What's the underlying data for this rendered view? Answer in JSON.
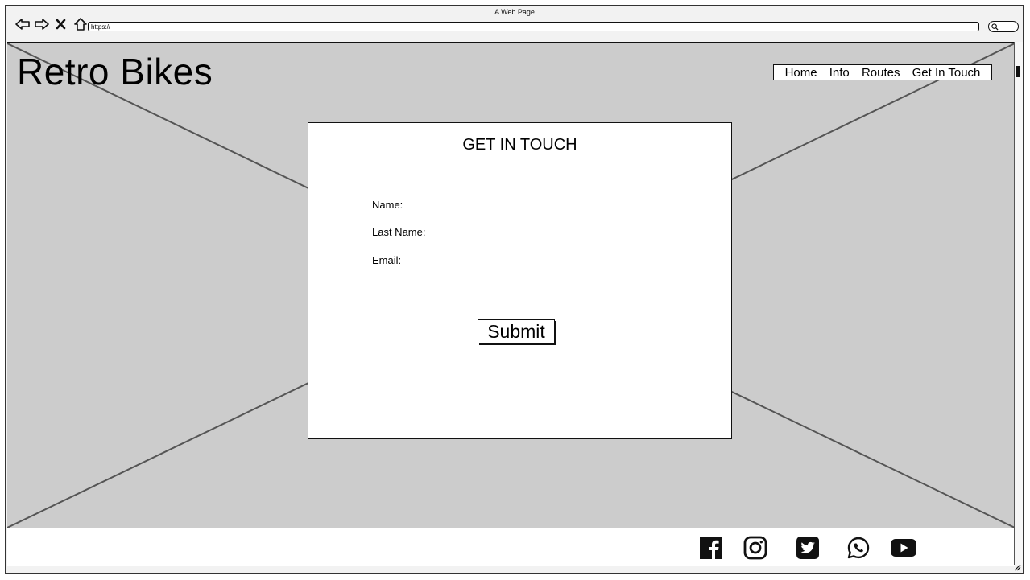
{
  "window": {
    "title": "A Web Page",
    "url": "https://"
  },
  "header": {
    "brand": "Retro Bikes"
  },
  "nav": {
    "items": [
      "Home",
      "Info",
      "Routes",
      "Get In Touch"
    ]
  },
  "form": {
    "title": "GET IN TOUCH",
    "fields": {
      "name": "Name:",
      "last_name": "Last Name:",
      "email": "Email:"
    },
    "submit_label": "Submit"
  },
  "footer": {
    "social_icons": [
      "facebook-icon",
      "instagram-icon",
      "twitter-icon",
      "whatsapp-icon",
      "youtube-icon"
    ]
  }
}
